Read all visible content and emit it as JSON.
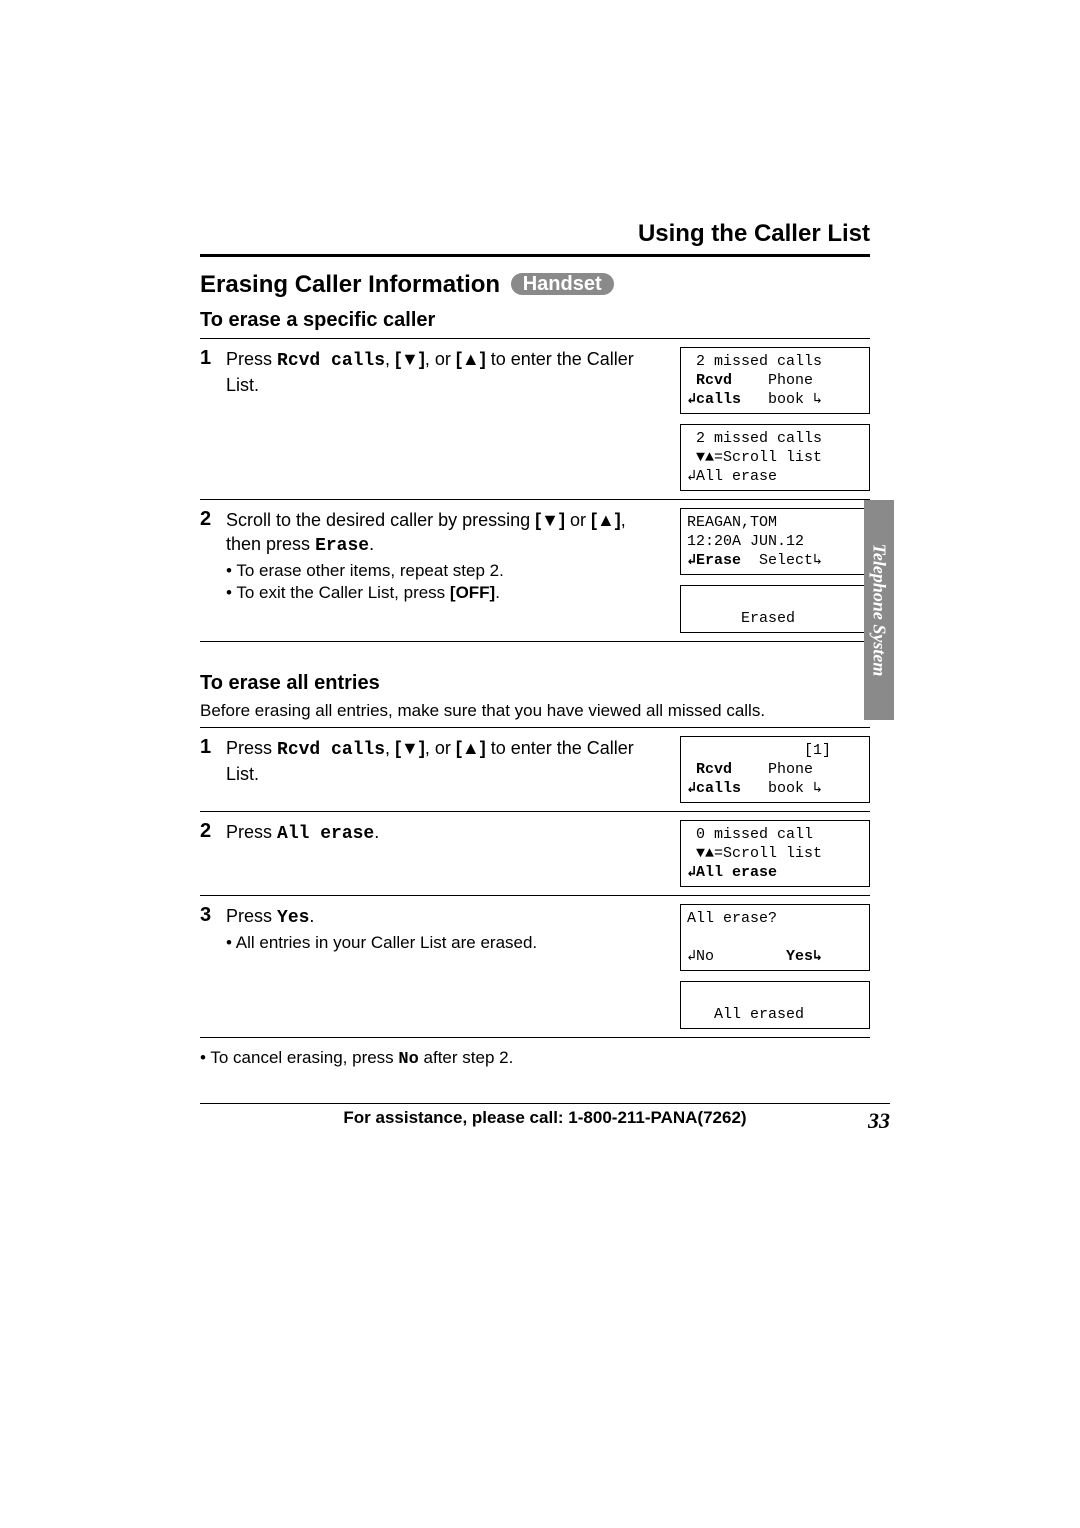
{
  "header": {
    "section_title": "Using the Caller List",
    "page_title": "Erasing Caller Information",
    "badge": "Handset"
  },
  "side_tab": "Telephone System",
  "specific": {
    "heading": "To erase a specific caller",
    "step1": {
      "num": "1",
      "text_a": "Press ",
      "key": "Rcvd calls",
      "text_b": ", ",
      "down": "[▼]",
      "text_c": ", or ",
      "up": "[▲]",
      "text_d": " to enter the Caller List.",
      "lcd1_l1": " 2 missed calls",
      "lcd1_l2a": " Rcvd",
      "lcd1_l2b": "    Phone",
      "lcd1_l3a": "↲calls",
      "lcd1_l3b": "   book ↳",
      "lcd2_l1": " 2 missed calls",
      "lcd2_l2": " ▼▲=Scroll list",
      "lcd2_l3": "↲All erase"
    },
    "step2": {
      "num": "2",
      "text_a": "Scroll to the desired caller by pressing ",
      "down": "[▼]",
      "text_b": " or ",
      "up": "[▲]",
      "text_c": ", then press ",
      "key": "Erase",
      "text_d": ".",
      "bullet1": "To erase other items, repeat step 2.",
      "bullet2_a": "To exit the Caller List, press ",
      "bullet2_b": "[OFF]",
      "bullet2_c": ".",
      "lcd1_l1": "REAGAN,TOM",
      "lcd1_l2": "12:20A JUN.12",
      "lcd1_l3a": "↲Erase",
      "lcd1_l3b": "  Select↳",
      "lcd2_l1": "",
      "lcd2_l2": "      Erased",
      "lcd2_l3": ""
    }
  },
  "all": {
    "heading": "To erase all entries",
    "intro": "Before erasing all entries, make sure that you have viewed all missed calls.",
    "step1": {
      "num": "1",
      "text_a": "Press ",
      "key": "Rcvd calls",
      "text_b": ", ",
      "down": "[▼]",
      "text_c": ", or ",
      "up": "[▲]",
      "text_d": " to enter the Caller List.",
      "lcd_l1": "             [1]",
      "lcd_l2a": " Rcvd",
      "lcd_l2b": "    Phone",
      "lcd_l3a": "↲calls",
      "lcd_l3b": "   book ↳"
    },
    "step2": {
      "num": "2",
      "text_a": "Press ",
      "key": "All erase",
      "text_b": ".",
      "lcd_l1": " 0 missed call",
      "lcd_l2": " ▼▲=Scroll list",
      "lcd_l3": "↲All erase"
    },
    "step3": {
      "num": "3",
      "text_a": "Press ",
      "key": "Yes",
      "text_b": ".",
      "bullet1": "All entries in your Caller List are erased.",
      "lcd1_l1": "All erase?",
      "lcd1_l2": "",
      "lcd1_l3a": "↲No",
      "lcd1_l3b": "        Yes↳",
      "lcd2_l1": "",
      "lcd2_l2": "   All erased",
      "lcd2_l3": ""
    },
    "cancel_note_a": "• To cancel erasing, press ",
    "cancel_note_key": "No",
    "cancel_note_b": " after step 2."
  },
  "footer": {
    "assist": "For assistance, please call: 1-800-211-PANA(7262)",
    "page_num": "33"
  }
}
